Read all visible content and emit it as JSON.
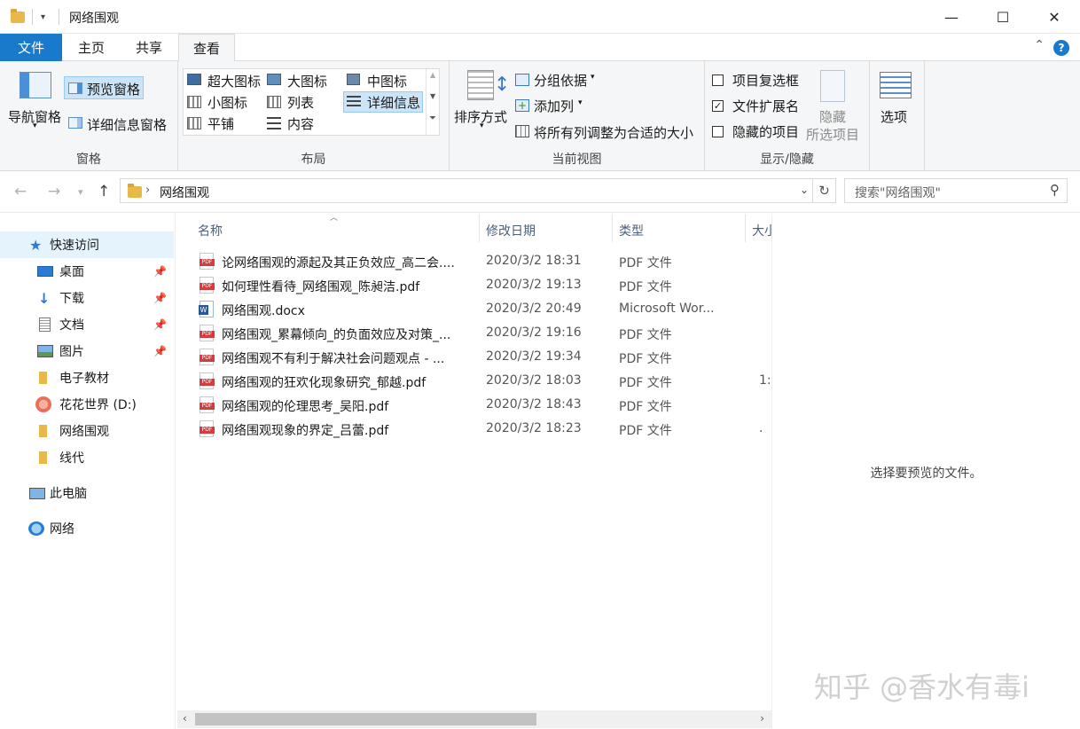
{
  "window": {
    "title": "网络围观",
    "minimize": "—",
    "maximize": "☐",
    "close": "✕"
  },
  "tabs": [
    {
      "label": "文件"
    },
    {
      "label": "主页"
    },
    {
      "label": "共享"
    },
    {
      "label": "查看"
    }
  ],
  "ribbon": {
    "panes": {
      "nav_pane": "导航窗格",
      "preview_pane": "预览窗格",
      "details_pane": "详细信息窗格",
      "label": "窗格"
    },
    "layout": {
      "extra_large": "超大图标",
      "large": "大图标",
      "medium": "中图标",
      "small": "小图标",
      "list": "列表",
      "details": "详细信息",
      "tiles": "平铺",
      "content": "内容",
      "label": "布局"
    },
    "current_view": {
      "sort_by": "排序方式",
      "group_by": "分组依据",
      "add_columns": "添加列",
      "size_all_columns": "将所有列调整为合适的大小",
      "label": "当前视图"
    },
    "show_hide": {
      "item_checkboxes": "项目复选框",
      "file_extensions": "文件扩展名",
      "hidden_items": "隐藏的项目",
      "hide_selected_1": "隐藏",
      "hide_selected_2": "所选项目",
      "label": "显示/隐藏",
      "item_checkboxes_checked": false,
      "file_extensions_checked": true,
      "hidden_items_checked": false
    },
    "options": "选项"
  },
  "address": {
    "path": "网络围观",
    "search_placeholder": "搜索\"网络围观\""
  },
  "nav": {
    "quick_access": "快速访问",
    "items": [
      {
        "label": "桌面",
        "pinned": true
      },
      {
        "label": "下载",
        "pinned": true
      },
      {
        "label": "文档",
        "pinned": true
      },
      {
        "label": "图片",
        "pinned": true
      },
      {
        "label": "电子教材",
        "pinned": false
      },
      {
        "label": "花花世界 (D:)",
        "pinned": false
      },
      {
        "label": "网络围观",
        "pinned": false
      },
      {
        "label": "线代",
        "pinned": false
      }
    ],
    "this_pc": "此电脑",
    "network": "网络"
  },
  "columns": {
    "name": "名称",
    "date": "修改日期",
    "type": "类型",
    "size": "大小"
  },
  "files": [
    {
      "name": "论网络围观的源起及其正负效应_高二会....",
      "date": "2020/3/2 18:31",
      "type": "PDF 文件",
      "size": "",
      "kind": "pdf"
    },
    {
      "name": "如何理性看待_网络围观_陈昶洁.pdf",
      "date": "2020/3/2 19:13",
      "type": "PDF 文件",
      "size": "",
      "kind": "pdf"
    },
    {
      "name": "网络围观.docx",
      "date": "2020/3/2 20:49",
      "type": "Microsoft Wor...",
      "size": "",
      "kind": "doc"
    },
    {
      "name": "网络围观_累幕倾向_的负面效应及对策_...",
      "date": "2020/3/2 19:16",
      "type": "PDF 文件",
      "size": "",
      "kind": "pdf"
    },
    {
      "name": "网络围观不有利于解决社会问题观点 - ...",
      "date": "2020/3/2 19:34",
      "type": "PDF 文件",
      "size": "",
      "kind": "pdf"
    },
    {
      "name": "网络围观的狂欢化现象研究_郁越.pdf",
      "date": "2020/3/2 18:03",
      "type": "PDF 文件",
      "size": "1:",
      "kind": "pdf"
    },
    {
      "name": "网络围观的伦理思考_吴阳.pdf",
      "date": "2020/3/2 18:43",
      "type": "PDF 文件",
      "size": "",
      "kind": "pdf"
    },
    {
      "name": "网络围观现象的界定_吕蕾.pdf",
      "date": "2020/3/2 18:23",
      "type": "PDF 文件",
      "size": ".",
      "kind": "pdf"
    }
  ],
  "preview": {
    "message": "选择要预览的文件。"
  },
  "watermark": "知乎 @香水有毒i"
}
